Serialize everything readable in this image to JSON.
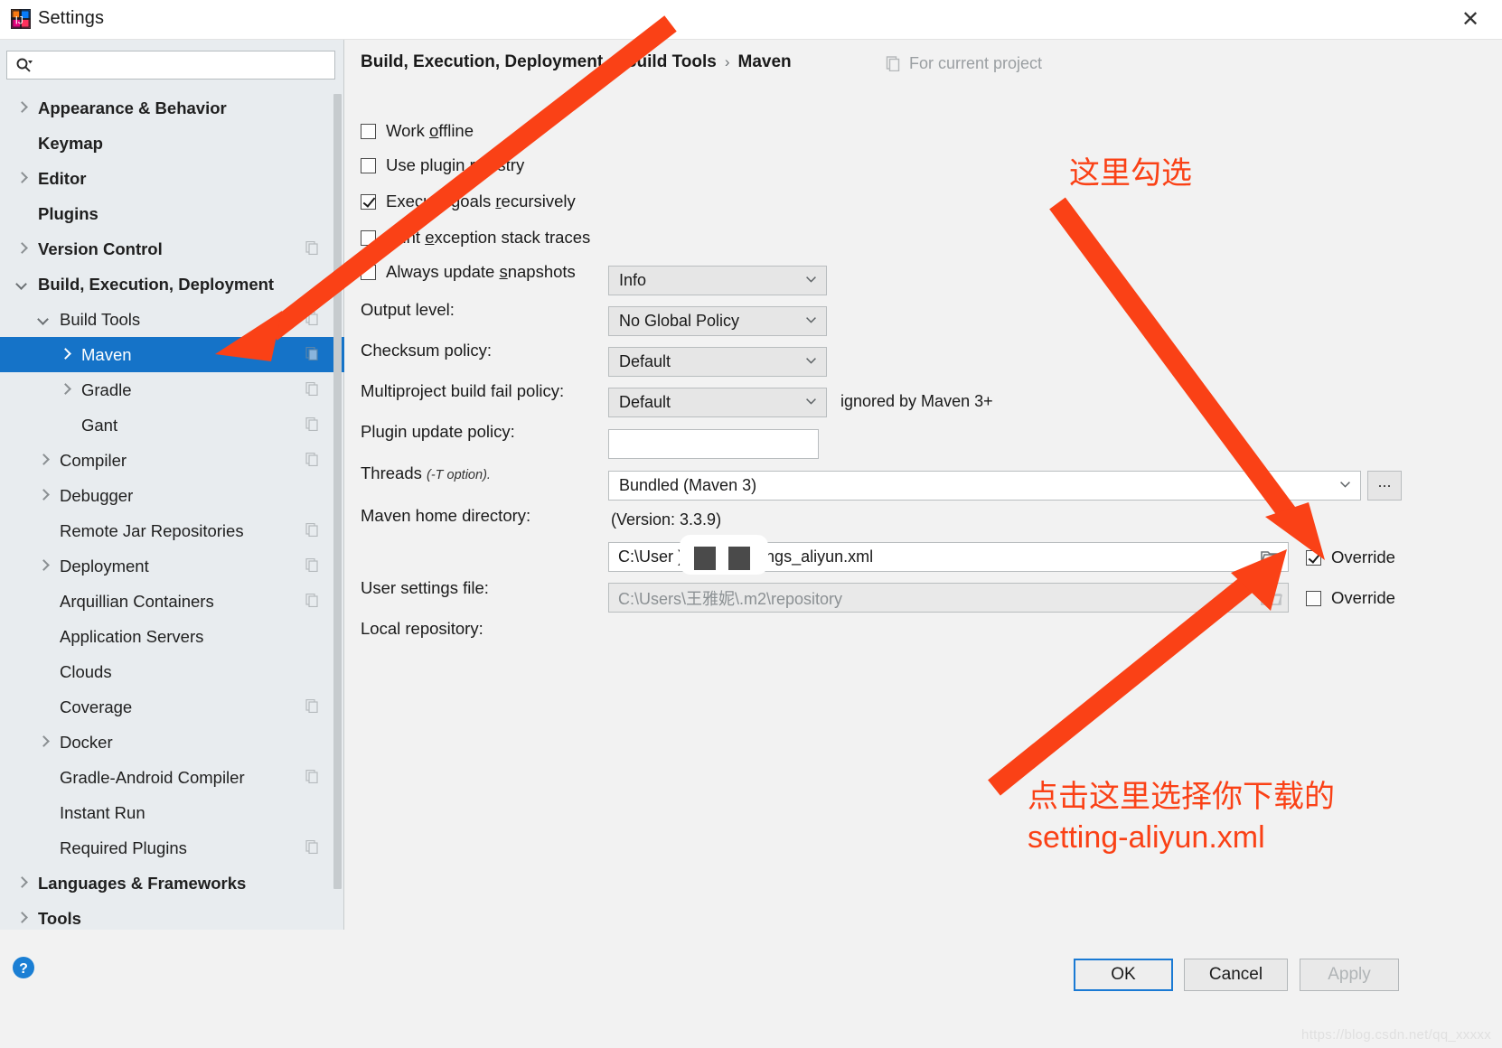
{
  "window": {
    "title": "Settings",
    "close_label": "✕",
    "app_icon": "intellij-idea-icon"
  },
  "search": {
    "value": "",
    "placeholder": "",
    "icon": "search-icon"
  },
  "sidebar": {
    "items": [
      {
        "label": "Appearance & Behavior",
        "indent": 0,
        "arrow": "right",
        "bold": true,
        "badge": false,
        "selected": false
      },
      {
        "label": "Keymap",
        "indent": 0,
        "arrow": "none",
        "bold": true,
        "badge": false,
        "selected": false
      },
      {
        "label": "Editor",
        "indent": 0,
        "arrow": "right",
        "bold": true,
        "badge": false,
        "selected": false
      },
      {
        "label": "Plugins",
        "indent": 0,
        "arrow": "none",
        "bold": true,
        "badge": false,
        "selected": false
      },
      {
        "label": "Version Control",
        "indent": 0,
        "arrow": "right",
        "bold": true,
        "badge": true,
        "selected": false
      },
      {
        "label": "Build, Execution, Deployment",
        "indent": 0,
        "arrow": "down",
        "bold": true,
        "badge": false,
        "selected": false
      },
      {
        "label": "Build Tools",
        "indent": 1,
        "arrow": "down",
        "bold": false,
        "badge": true,
        "selected": false
      },
      {
        "label": "Maven",
        "indent": 2,
        "arrow": "right",
        "bold": false,
        "badge": true,
        "selected": true
      },
      {
        "label": "Gradle",
        "indent": 2,
        "arrow": "right",
        "bold": false,
        "badge": true,
        "selected": false
      },
      {
        "label": "Gant",
        "indent": 2,
        "arrow": "none",
        "bold": false,
        "badge": true,
        "selected": false
      },
      {
        "label": "Compiler",
        "indent": 1,
        "arrow": "right",
        "bold": false,
        "badge": true,
        "selected": false
      },
      {
        "label": "Debugger",
        "indent": 1,
        "arrow": "right",
        "bold": false,
        "badge": false,
        "selected": false
      },
      {
        "label": "Remote Jar Repositories",
        "indent": 1,
        "arrow": "none",
        "bold": false,
        "badge": true,
        "selected": false
      },
      {
        "label": "Deployment",
        "indent": 1,
        "arrow": "right",
        "bold": false,
        "badge": true,
        "selected": false
      },
      {
        "label": "Arquillian Containers",
        "indent": 1,
        "arrow": "none",
        "bold": false,
        "badge": true,
        "selected": false
      },
      {
        "label": "Application Servers",
        "indent": 1,
        "arrow": "none",
        "bold": false,
        "badge": false,
        "selected": false
      },
      {
        "label": "Clouds",
        "indent": 1,
        "arrow": "none",
        "bold": false,
        "badge": false,
        "selected": false
      },
      {
        "label": "Coverage",
        "indent": 1,
        "arrow": "none",
        "bold": false,
        "badge": true,
        "selected": false
      },
      {
        "label": "Docker",
        "indent": 1,
        "arrow": "right",
        "bold": false,
        "badge": false,
        "selected": false
      },
      {
        "label": "Gradle-Android Compiler",
        "indent": 1,
        "arrow": "none",
        "bold": false,
        "badge": true,
        "selected": false
      },
      {
        "label": "Instant Run",
        "indent": 1,
        "arrow": "none",
        "bold": false,
        "badge": false,
        "selected": false
      },
      {
        "label": "Required Plugins",
        "indent": 1,
        "arrow": "none",
        "bold": false,
        "badge": true,
        "selected": false
      },
      {
        "label": "Languages & Frameworks",
        "indent": 0,
        "arrow": "right",
        "bold": true,
        "badge": false,
        "selected": false
      },
      {
        "label": "Tools",
        "indent": 0,
        "arrow": "right",
        "bold": true,
        "badge": false,
        "selected": false
      }
    ]
  },
  "main": {
    "breadcrumb": [
      "Build, Execution, Deployment",
      "Build Tools",
      "Maven"
    ],
    "breadcrumb_separator": "›",
    "for_current_project": "For current project",
    "checkboxes": [
      {
        "label_pre": "Work ",
        "mnemonic": "o",
        "label_post": "ffline",
        "checked": false
      },
      {
        "label_pre": "Use plugin ",
        "mnemonic": "r",
        "label_post": "egistry",
        "checked": false
      },
      {
        "label_pre": "Execute goals ",
        "mnemonic": "r",
        "label_post": "ecursively",
        "checked": true
      },
      {
        "label_pre": "Print ",
        "mnemonic": "e",
        "label_post": "xception stack traces",
        "checked": false
      },
      {
        "label_pre": "Always update ",
        "mnemonic": "s",
        "label_post": "napshots",
        "checked": false
      }
    ],
    "fields": {
      "output_level": {
        "label": "Output level:",
        "value": "Info"
      },
      "checksum_policy": {
        "label": "Checksum policy:",
        "value": "No Global Policy"
      },
      "multiproject_fail_policy": {
        "label": "Multiproject build fail policy:",
        "value": "Default"
      },
      "plugin_update_policy": {
        "label": "Plugin update policy:",
        "value": "Default",
        "note": "ignored by Maven 3+"
      },
      "threads": {
        "label": "Threads",
        "label_sub": "(-T option).",
        "value": ""
      },
      "maven_home": {
        "label": "Maven home directory:",
        "value": "Bundled (Maven 3)",
        "version_note": "(Version: 3.3.9)",
        "dots_label": "..."
      },
      "user_settings_file": {
        "label": "User settings file:",
        "value": "C:\\User                )esktop\\settings_aliyun.xml",
        "override_label": "Override",
        "override_checked": true,
        "browse_icon": "folder-icon"
      },
      "local_repository": {
        "label": "Local repository:",
        "value": "C:\\Users\\王雅妮\\.m2\\repository",
        "override_label": "Override",
        "override_checked": false,
        "browse_icon": "folder-icon"
      }
    }
  },
  "footer": {
    "help_icon": "help-icon",
    "ok_label": "OK",
    "cancel_label": "Cancel",
    "apply_label": "Apply",
    "apply_disabled": true,
    "watermark": "https://blog.csdn.net/qq_xxxxx"
  },
  "annotations": {
    "accent_color": "#fa4116",
    "note_checkbox": "这里勾选",
    "note_browse": "点击这里选择你下载的\nsetting-aliyun.xml"
  }
}
